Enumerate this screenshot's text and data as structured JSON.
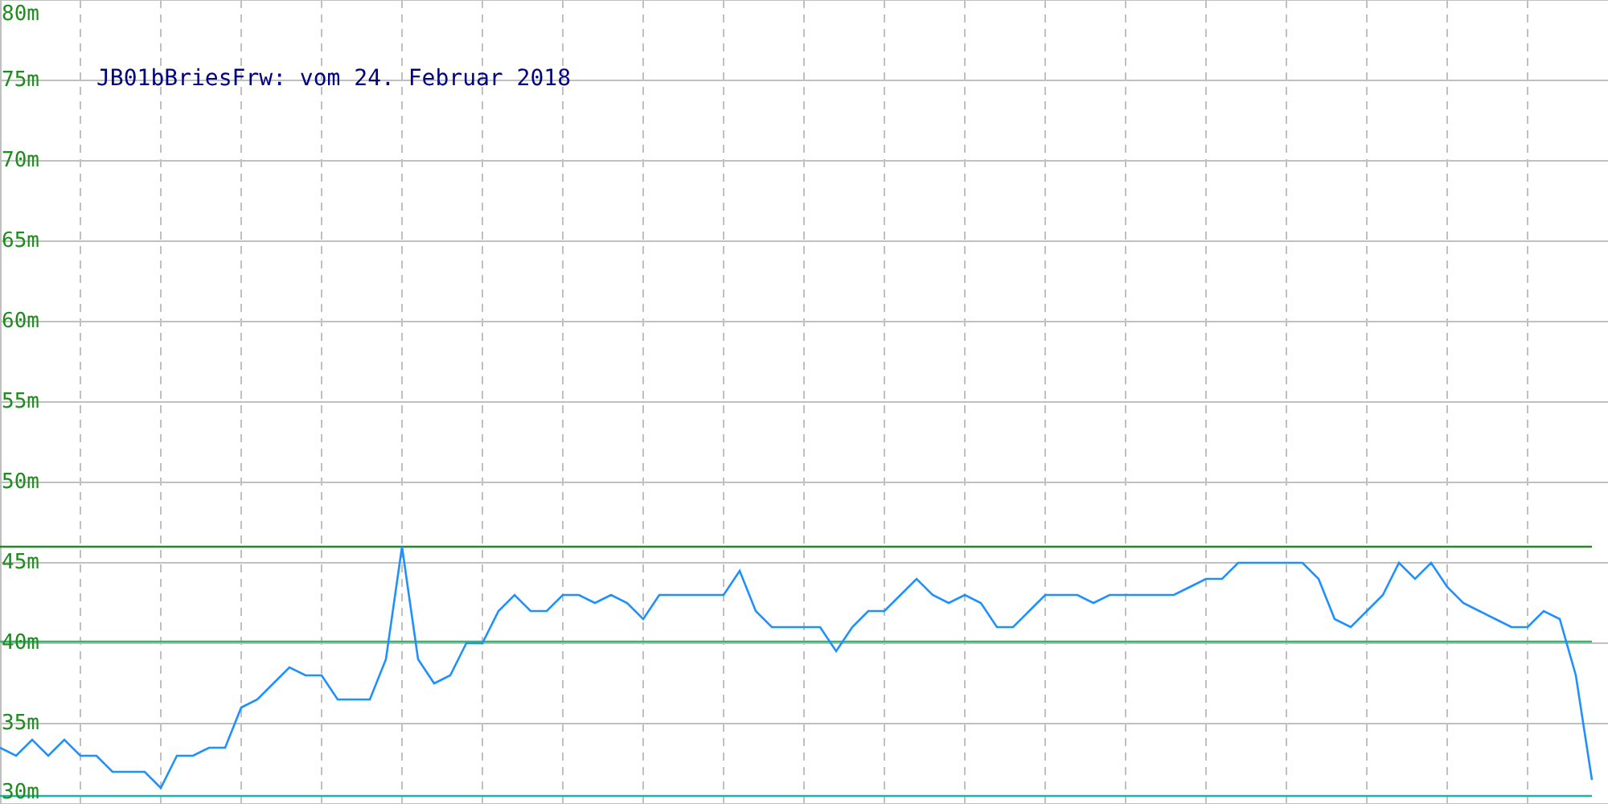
{
  "chart": {
    "chart_data": {
      "type": "line",
      "title": "JB01bBriesFrw: vom 24. Februar 2018",
      "ylim": [
        30,
        80
      ],
      "yticks": [
        {
          "value": 30,
          "label": "30m"
        },
        {
          "value": 35,
          "label": "35m"
        },
        {
          "value": 40,
          "label": "40m"
        },
        {
          "value": 45,
          "label": "45m"
        },
        {
          "value": 50,
          "label": "50m"
        },
        {
          "value": 55,
          "label": "55m"
        },
        {
          "value": 60,
          "label": "60m"
        },
        {
          "value": 65,
          "label": "65m"
        },
        {
          "value": 70,
          "label": "70m"
        },
        {
          "value": 75,
          "label": "75m"
        },
        {
          "value": 80,
          "label": "80m"
        }
      ],
      "grid": true,
      "series": [
        {
          "color": "#1e90ff",
          "values": [
            33.5,
            33,
            34,
            33,
            34,
            33,
            33,
            32,
            32,
            32,
            31,
            33,
            33,
            33.5,
            33.5,
            36,
            36.5,
            37.5,
            38.5,
            38,
            38,
            36.5,
            36.5,
            36.5,
            39,
            46,
            39,
            37.5,
            38,
            40,
            40,
            42,
            43,
            42,
            42,
            43,
            43,
            42.5,
            43,
            42.5,
            41.5,
            43,
            43,
            43,
            43,
            43,
            44.5,
            42,
            41,
            41,
            41,
            41,
            39.5,
            41,
            42,
            42,
            43,
            44,
            43,
            42.5,
            43,
            42.5,
            41,
            41,
            42,
            43,
            43,
            43,
            42.5,
            43,
            43,
            43,
            43,
            43,
            43.5,
            44,
            44,
            45,
            45,
            45,
            45,
            45,
            44,
            41.5,
            41,
            42,
            43,
            45,
            44,
            45,
            43.5,
            42.5,
            42,
            41.5,
            41,
            41,
            42,
            41.5,
            38,
            31.5
          ]
        },
        {
          "color": "#1e8c1e",
          "values": [
            46,
            46,
            46,
            46,
            46,
            46,
            46,
            46,
            46,
            46,
            46,
            46,
            46,
            46,
            46,
            46,
            46,
            46,
            46,
            46,
            46,
            46,
            46,
            46,
            46,
            46,
            46,
            46,
            46,
            46,
            46,
            46,
            46,
            46,
            46,
            46,
            46,
            46,
            46,
            46,
            46,
            46,
            46,
            46,
            46,
            46,
            46,
            46,
            46,
            46,
            46,
            46,
            46,
            46,
            46,
            46,
            46,
            46,
            46,
            46,
            46,
            46,
            46,
            46,
            46,
            46,
            46,
            46,
            46,
            46,
            46,
            46,
            46,
            46,
            46,
            46,
            46,
            46,
            46,
            46,
            46,
            46,
            46,
            46,
            46,
            46,
            46,
            46,
            46,
            46,
            46,
            46,
            46,
            46,
            46,
            46,
            46,
            46,
            46,
            46
          ]
        },
        {
          "color": "#3cb371",
          "values": [
            40.1,
            40.1,
            40.1,
            40.1,
            40.1,
            40.1,
            40.1,
            40.1,
            40.1,
            40.1,
            40.1,
            40.1,
            40.1,
            40.1,
            40.1,
            40.1,
            40.1,
            40.1,
            40.1,
            40.1,
            40.1,
            40.1,
            40.1,
            40.1,
            40.1,
            40.1,
            40.1,
            40.1,
            40.1,
            40.1,
            40.1,
            40.1,
            40.1,
            40.1,
            40.1,
            40.1,
            40.1,
            40.1,
            40.1,
            40.1,
            40.1,
            40.1,
            40.1,
            40.1,
            40.1,
            40.1,
            40.1,
            40.1,
            40.1,
            40.1,
            40.1,
            40.1,
            40.1,
            40.1,
            40.1,
            40.1,
            40.1,
            40.1,
            40.1,
            40.1,
            40.1,
            40.1,
            40.1,
            40.1,
            40.1,
            40.1,
            40.1,
            40.1,
            40.1,
            40.1,
            40.1,
            40.1,
            40.1,
            40.1,
            40.1,
            40.1,
            40.1,
            40.1,
            40.1,
            40.1,
            40.1,
            40.1,
            40.1,
            40.1,
            40.1,
            40.1,
            40.1,
            40.1,
            40.1,
            40.1,
            40.1,
            40.1,
            40.1,
            40.1,
            40.1,
            40.1,
            40.1,
            40.1,
            40.1,
            40.1
          ]
        },
        {
          "color": "#20b2aa",
          "values": [
            30.5,
            30.5,
            30.5,
            30.5,
            30.5,
            30.5,
            30.5,
            30.5,
            30.5,
            30.5,
            30.5,
            30.5,
            30.5,
            30.5,
            30.5,
            30.5,
            30.5,
            30.5,
            30.5,
            30.5,
            30.5,
            30.5,
            30.5,
            30.5,
            30.5,
            30.5,
            30.5,
            30.5,
            30.5,
            30.5,
            30.5,
            30.5,
            30.5,
            30.5,
            30.5,
            30.5,
            30.5,
            30.5,
            30.5,
            30.5,
            30.5,
            30.5,
            30.5,
            30.5,
            30.5,
            30.5,
            30.5,
            30.5,
            30.5,
            30.5,
            30.5,
            30.5,
            30.5,
            30.5,
            30.5,
            30.5,
            30.5,
            30.5,
            30.5,
            30.5,
            30.5,
            30.5,
            30.5,
            30.5,
            30.5,
            30.5,
            30.5,
            30.5,
            30.5,
            30.5,
            30.5,
            30.5,
            30.5,
            30.5,
            30.5,
            30.5,
            30.5,
            30.5,
            30.5,
            30.5,
            30.5,
            30.5,
            30.5,
            30.5,
            30.5,
            30.5,
            30.5,
            30.5,
            30.5,
            30.5,
            30.5,
            30.5,
            30.5,
            30.5,
            30.5,
            30.5,
            30.5,
            30.5,
            30.5,
            30.5
          ]
        }
      ]
    }
  }
}
